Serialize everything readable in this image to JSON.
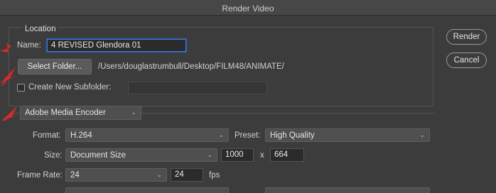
{
  "window": {
    "title": "Render Video"
  },
  "location": {
    "group_label": "Location",
    "name_label": "Name:",
    "name_value": "4 REVISED Glendora 01",
    "select_folder_label": "Select Folder...",
    "folder_path": "/Users/douglastrumbull/Desktop/FILM48/ANIMATE/",
    "subfolder_label": "Create New Subfolder:",
    "subfolder_value": ""
  },
  "actions": {
    "render_label": "Render",
    "cancel_label": "Cancel"
  },
  "encoder": {
    "selected": "Adobe Media Encoder"
  },
  "settings": {
    "format_label": "Format:",
    "format_value": "H.264",
    "preset_label": "Preset:",
    "preset_value": "High Quality",
    "size_label": "Size:",
    "size_value": "Document Size",
    "width": "1000",
    "size_x": "x",
    "height": "664",
    "frame_rate_label": "Frame Rate:",
    "frame_rate_value": "24",
    "frame_rate_field": "24",
    "fps_label": "fps"
  },
  "colors": {
    "annotation_arrow": "#d42a2a",
    "focus_ring": "#3f78d6"
  }
}
